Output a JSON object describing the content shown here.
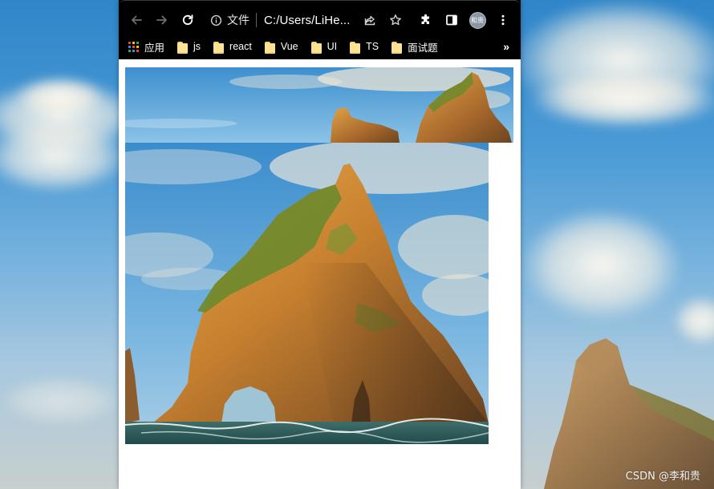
{
  "browser": {
    "site_info_label": "文件",
    "url": "C:/Users/LiHe...",
    "avatar_text": "和贵"
  },
  "bookmarks": [
    {
      "label": "应用",
      "icon": "apps-grid-icon"
    },
    {
      "label": "js",
      "icon": "folder-icon"
    },
    {
      "label": "react",
      "icon": "folder-icon"
    },
    {
      "label": "Vue",
      "icon": "folder-icon"
    },
    {
      "label": "UI",
      "icon": "folder-icon"
    },
    {
      "label": "TS",
      "icon": "folder-icon"
    },
    {
      "label": "面试题",
      "icon": "folder-icon"
    }
  ],
  "more_bookmarks": "»",
  "watermark": "CSDN @李和贵",
  "colors": {
    "toolbar_bg": "#000000",
    "folder_yellow": "#fde293",
    "page_bg": "#ffffff",
    "sky_blue": "#4a9ad6",
    "rock_gold": "#d9953a",
    "moss_green": "#5f7a2a"
  }
}
